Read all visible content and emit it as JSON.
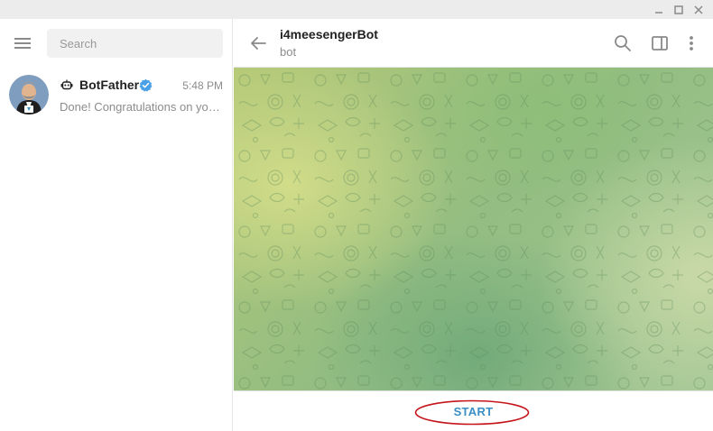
{
  "search": {
    "placeholder": "Search"
  },
  "chats": [
    {
      "name": "BotFather",
      "time": "5:48 PM",
      "preview": "Done! Congratulations on your new bot. You will find it at t.me/"
    }
  ],
  "header": {
    "title": "i4meesengerBot",
    "status": "bot"
  },
  "bottom": {
    "start_label": "START"
  },
  "colors": {
    "accent": "#3a8fc4",
    "verified": "#4aa0e6",
    "annotation": "#c4161c"
  },
  "icons": [
    "minimize-icon",
    "maximize-icon",
    "close-icon",
    "menu-icon",
    "bot-icon",
    "verified-icon",
    "back-arrow-icon",
    "search-icon",
    "sidebar-toggle-icon",
    "more-vertical-icon"
  ]
}
